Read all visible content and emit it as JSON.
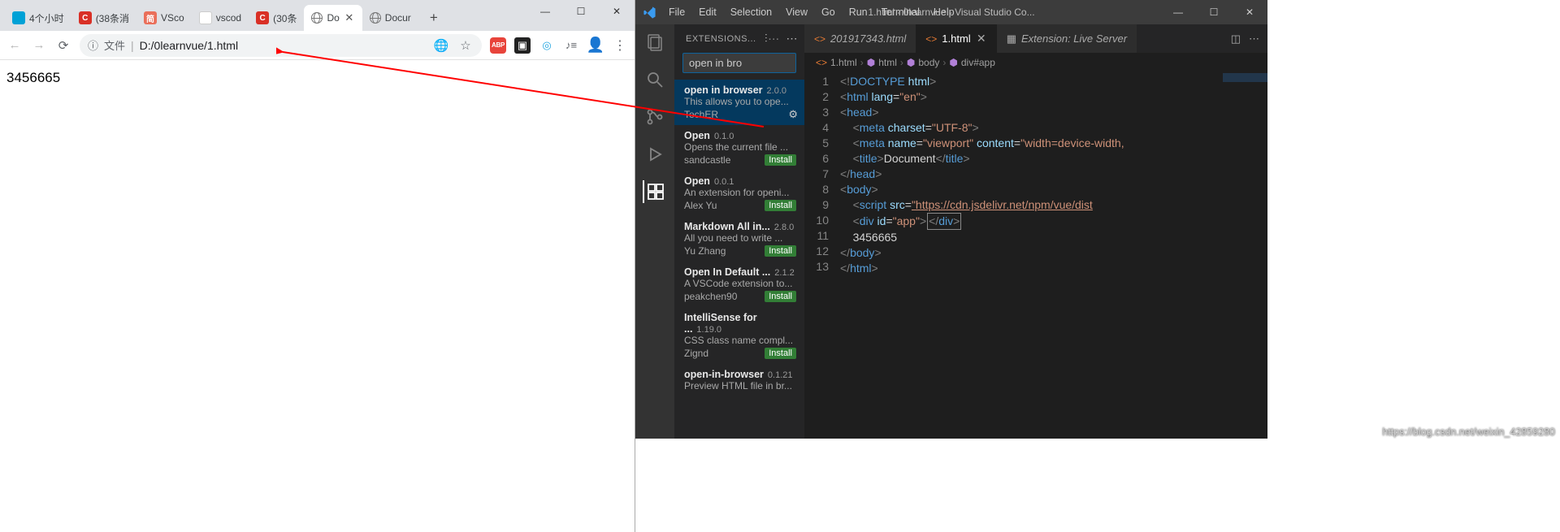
{
  "browser": {
    "tabs": [
      {
        "favClass": "fav-bili",
        "title": "4个小时"
      },
      {
        "favClass": "fav-csdn",
        "title": "(38条消"
      },
      {
        "favClass": "fav-jian",
        "title": "VSco"
      },
      {
        "favClass": "fav-baidu",
        "title": "vscod"
      },
      {
        "favClass": "fav-csdn",
        "title": "(30条"
      },
      {
        "favClass": "fav-globe",
        "title": "Do",
        "active": true
      },
      {
        "favClass": "fav-globe",
        "title": "Docur"
      }
    ],
    "win": {
      "min": "—",
      "max": "☐",
      "close": "✕"
    },
    "url_label": "文件",
    "url_path": "D:/0learnvue/1.html",
    "page_text": "3456665"
  },
  "vscode": {
    "menus": [
      "File",
      "Edit",
      "Selection",
      "View",
      "Go",
      "Run",
      "Terminal",
      "Help"
    ],
    "title": "1.html - 0learnvue - Visual Studio Co...",
    "sidebar_title": "EXTENSIONS...",
    "search_value": "open in bro",
    "extensions": [
      {
        "name": "open in browser",
        "ver": "2.0.0",
        "desc": "This allows you to ope...",
        "pub": "TechER",
        "install": "",
        "selected": true
      },
      {
        "name": "Open",
        "ver": "0.1.0",
        "desc": "Opens the current file ...",
        "pub": "sandcastle",
        "install": "Install"
      },
      {
        "name": "Open",
        "ver": "0.0.1",
        "desc": "An extension for openi...",
        "pub": "Alex Yu",
        "install": "Install"
      },
      {
        "name": "Markdown All in...",
        "ver": "2.8.0",
        "desc": "All you need to write ...",
        "pub": "Yu Zhang",
        "install": "Install"
      },
      {
        "name": "Open In Default ...",
        "ver": "2.1.2",
        "desc": "A VSCode extension to...",
        "pub": "peakchen90",
        "install": "Install"
      },
      {
        "name": "IntelliSense for ...",
        "ver": "1.19.0",
        "desc": "CSS class name compl...",
        "pub": "Zignd",
        "install": "Install"
      },
      {
        "name": "open-in-browser",
        "ver": "0.1.21",
        "desc": "Preview HTML file in br...",
        "pub": "",
        "install": ""
      }
    ],
    "editor_tabs": [
      {
        "label": "201917343.html",
        "active": false
      },
      {
        "label": "1.html",
        "active": true
      }
    ],
    "ext_tab": "Extension: Live Server",
    "crumbs": [
      "1.html",
      "html",
      "body",
      "div#app"
    ],
    "code_text": "3456665",
    "line_count": 13
  },
  "watermark": "https://blog.csdn.net/weixin_42859280"
}
